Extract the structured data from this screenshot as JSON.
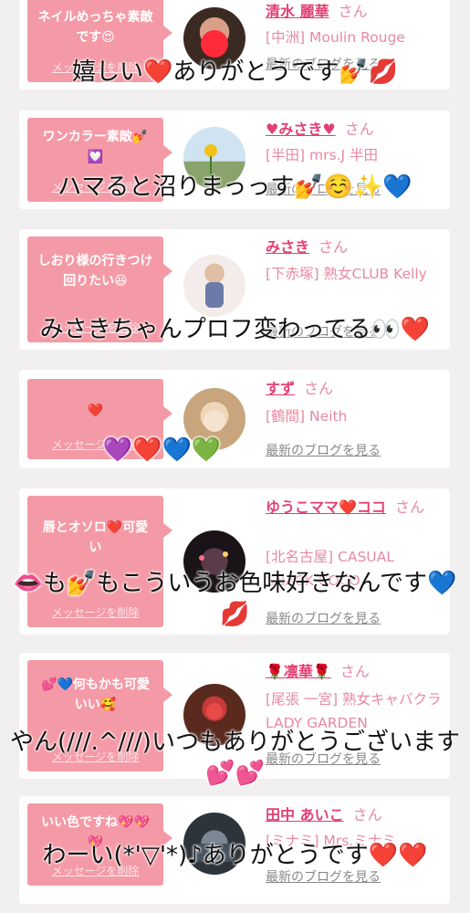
{
  "cards": [
    {
      "message": "ネイルめっちゃ素敵です😍",
      "delete_label": "メッセージを削除",
      "name": "清水 麗華",
      "honorific": "さん",
      "shop": "[中洲] Moulin Rouge",
      "blog_link": "最新のブログを見る",
      "overlay_text": "嬉しい❤️ありがとうです💅💋"
    },
    {
      "message": "ワンカラー素敵💅💟",
      "delete_label": "メッセージを削除",
      "name": "♥みさき♥",
      "honorific": "さん",
      "shop": "[半田] mrs.J 半田",
      "blog_link": "最新のブログを見る",
      "overlay_text": "ハマると沼りまっっす💅☺️✨💙"
    },
    {
      "message": "しおり様の行きつけ回りたい😆",
      "delete_label": "メッセージを削除",
      "name": "みさき",
      "honorific": "さん",
      "shop": "[下赤塚] 熟女CLUB Kelly",
      "blog_link": "最新のブログを見る",
      "overlay_text": "みさきちゃんプロフ変わってる👀❤️"
    },
    {
      "message": "❤️",
      "delete_label": "メッセージを削除",
      "name": "すず",
      "honorific": "さん",
      "shop": "[鶴間] Neith",
      "blog_link": "最新のブログを見る",
      "overlay_text": "💜❤️💙💚"
    },
    {
      "message": "唇とオソロ❤️可愛い",
      "delete_label": "メッセージを削除",
      "name": "ゆうこママ❤️ココ",
      "honorific": "さん",
      "shop": "[北名古屋] CASUAL SNACK COCO",
      "blog_link": "最新のブログを見る",
      "overlay_text": "👄も💅もこういうお色味好きなんです💙💋"
    },
    {
      "message": "💕💙何もかも可愛いい🥰",
      "delete_label": "メッセージを削除",
      "name": "🌹凛華🌹",
      "honorific": "さん",
      "shop": "[尾張 一宮] 熟女キャバクラ LADY GARDEN",
      "blog_link": "最新のブログを見る",
      "overlay_text": "やん(///.^///)いつもありがとうございます💕💕"
    },
    {
      "message": "いい色ですね💖💖💖",
      "delete_label": "メッセージを削除",
      "name": "田中 あいこ",
      "honorific": "さん",
      "shop": "[ミナミ] Mrs.ミナミ",
      "blog_link": "最新のブログを見る",
      "overlay_text": "わーい(*'▽'*)♪ありがとうです❤️❤️"
    }
  ],
  "colors": {
    "background": "#f1eff0",
    "bubble": "#f49aa6",
    "name": "#e23f72",
    "shop": "#e889a1"
  }
}
